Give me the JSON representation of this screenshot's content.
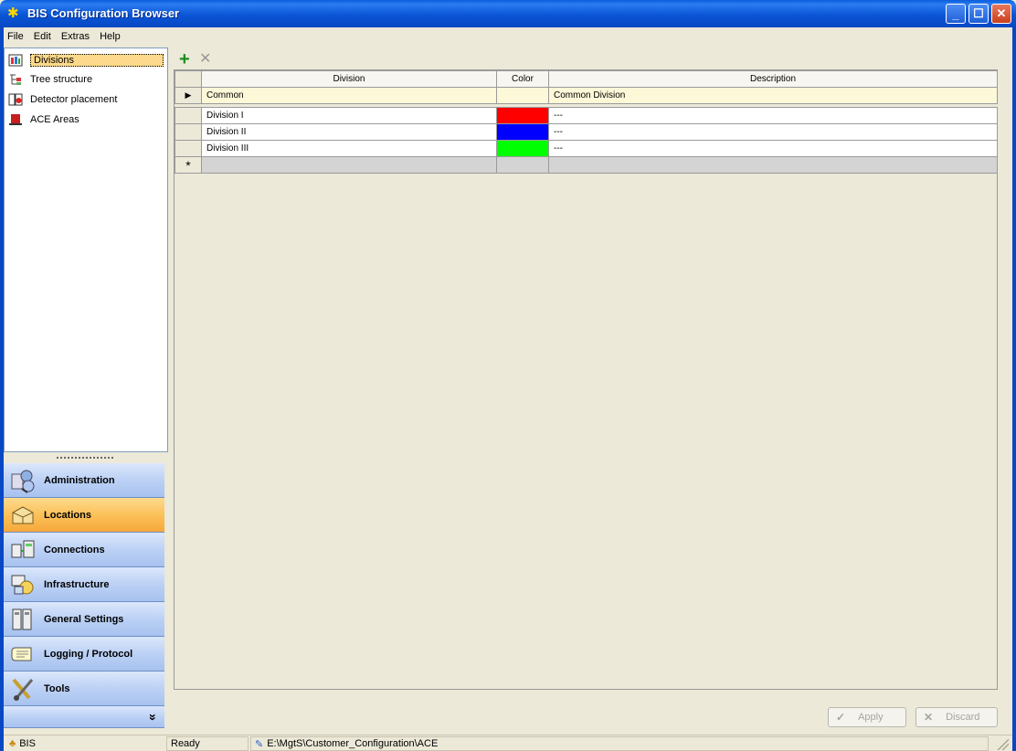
{
  "window": {
    "title": "BIS Configuration Browser",
    "controls": [
      "minimize",
      "maximize",
      "close"
    ]
  },
  "menu": [
    "File",
    "Edit",
    "Extras",
    "Help"
  ],
  "tree": {
    "items": [
      {
        "label": "Divisions",
        "icon": "divisions-icon",
        "selected": true
      },
      {
        "label": "Tree structure",
        "icon": "tree-structure-icon",
        "selected": false
      },
      {
        "label": "Detector placement",
        "icon": "detector-placement-icon",
        "selected": false
      },
      {
        "label": "ACE Areas",
        "icon": "ace-areas-icon",
        "selected": false
      }
    ]
  },
  "nav": {
    "buttons": [
      {
        "label": "Administration",
        "icon": "administration-icon",
        "active": false
      },
      {
        "label": "Locations",
        "icon": "locations-icon",
        "active": true
      },
      {
        "label": "Connections",
        "icon": "connections-icon",
        "active": false
      },
      {
        "label": "Infrastructure",
        "icon": "infrastructure-icon",
        "active": false
      },
      {
        "label": "General Settings",
        "icon": "general-settings-icon",
        "active": false
      },
      {
        "label": "Logging / Protocol",
        "icon": "logging-protocol-icon",
        "active": false
      },
      {
        "label": "Tools",
        "icon": "tools-icon",
        "active": false
      }
    ],
    "more_glyph": "»"
  },
  "toolbar": {
    "add_icon": "add-icon",
    "delete_icon": "delete-icon"
  },
  "grid": {
    "columns": [
      "Division",
      "Color",
      "Description"
    ],
    "current_row_marker": "▶",
    "new_row_marker": "*",
    "current_row": {
      "division": "Common",
      "color": "#ffffff",
      "description": "Common Division"
    },
    "rows": [
      {
        "division": "Division I",
        "color": "#ff0000",
        "description": "---"
      },
      {
        "division": "Division II",
        "color": "#0000ff",
        "description": "---"
      },
      {
        "division": "Division III",
        "color": "#00ff00",
        "description": "---"
      }
    ]
  },
  "buttons": {
    "apply": "Apply",
    "discard": "Discard"
  },
  "status": {
    "user": "BIS",
    "state": "Ready",
    "path": "E:\\MgtS\\Customer_Configuration\\ACE"
  },
  "colors": {
    "title_bar": "#0a55d6",
    "nav_active": "#fbc15a",
    "nav_inactive": "#bcd1f5",
    "selection": "#fcd98c"
  }
}
